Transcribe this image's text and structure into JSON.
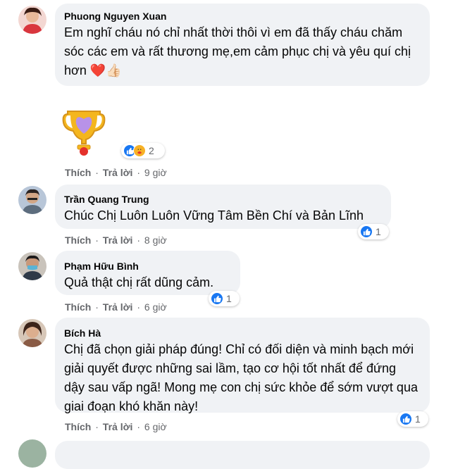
{
  "comments": [
    {
      "author": "Phuong Nguyen Xuan",
      "text": "Em nghĩ cháu nó chỉ nhất thời thôi vì em đã thấy cháu chăm sóc các em và rất thương mẹ,em cảm phục chị và yêu quí chị hơn",
      "emoji": "❤️👍🏻",
      "sticker": "trophy-heart-sticker",
      "reaction_count": "2",
      "reactions": [
        "like",
        "care"
      ],
      "like_label": "Thích",
      "reply_label": "Trả lời",
      "time": "9 giờ"
    },
    {
      "author": "Trần Quang Trung",
      "text": "Chúc Chị Luôn Luôn Vững Tâm Bền Chí và Bản Lĩnh",
      "reaction_count": "1",
      "reactions": [
        "like"
      ],
      "like_label": "Thích",
      "reply_label": "Trả lời",
      "time": "8 giờ"
    },
    {
      "author": "Phạm Hữu Bình",
      "text": "Quả thật chị rất dũng cảm.",
      "reaction_count": "1",
      "reactions": [
        "like"
      ],
      "like_label": "Thích",
      "reply_label": "Trả lời",
      "time": "6 giờ"
    },
    {
      "author": "Bích Hà",
      "text": "Chị đã chọn giải pháp đúng! Chỉ có đối diện và minh bạch mới giải quyết được những sai lầm, tạo cơ hội tốt nhất để đứng dậy sau vấp ngã! Mong mẹ con chị sức khỏe để sớm vượt qua giai đoạn khó khăn này!",
      "reaction_count": "1",
      "reactions": [
        "like"
      ],
      "like_label": "Thích",
      "reply_label": "Trả lời",
      "time": "6 giờ"
    }
  ],
  "colors": {
    "bubble": "#f0f2f5",
    "secondary_text": "#65676b",
    "like_blue": "#1877f2",
    "care_yellow": "#f7b125",
    "heart_red": "#e41e3f"
  }
}
